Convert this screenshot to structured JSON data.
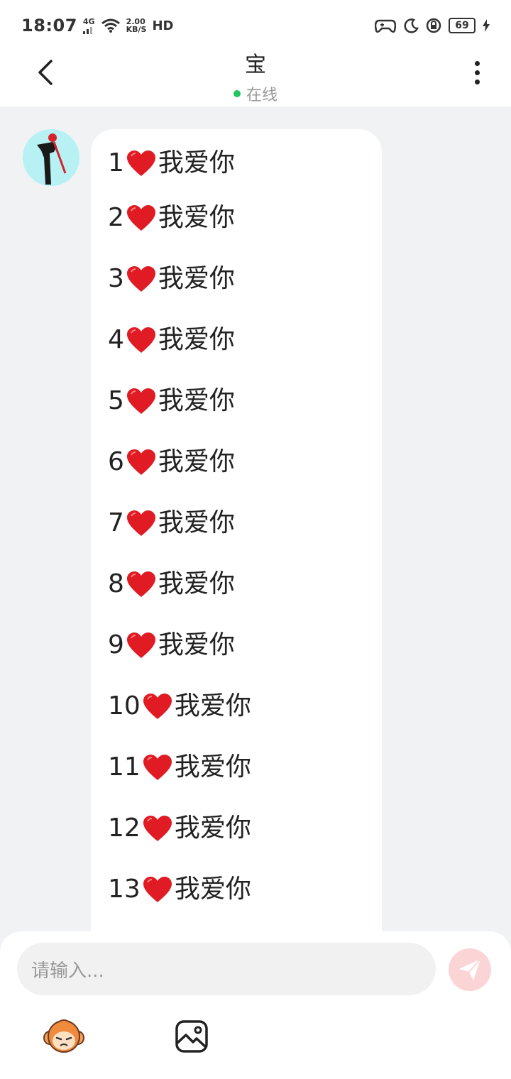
{
  "status_bar": {
    "time": "18:07",
    "network": "4G",
    "speed_value": "2.00",
    "speed_unit": "KB/S",
    "hd": "HD",
    "battery": "69"
  },
  "header": {
    "title": "宝",
    "status": "在线"
  },
  "messages": [
    {
      "num": "1",
      "text": "我爱你"
    },
    {
      "num": "2",
      "text": "我爱你"
    },
    {
      "num": "3",
      "text": "我爱你"
    },
    {
      "num": "4",
      "text": "我爱你"
    },
    {
      "num": "5",
      "text": "我爱你"
    },
    {
      "num": "6",
      "text": "我爱你"
    },
    {
      "num": "7",
      "text": "我爱你"
    },
    {
      "num": "8",
      "text": "我爱你"
    },
    {
      "num": "9",
      "text": "我爱你"
    },
    {
      "num": "10",
      "text": "我爱你"
    },
    {
      "num": "11",
      "text": "我爱你"
    },
    {
      "num": "12",
      "text": "我爱你"
    },
    {
      "num": "13",
      "text": "我爱你"
    }
  ],
  "composer": {
    "placeholder": "请输入..."
  },
  "icons": {
    "back": "chevron-left-icon",
    "more": "more-vertical-icon",
    "send": "paper-plane-icon",
    "emoji": "monkey-emoji-icon",
    "image": "image-icon"
  },
  "colors": {
    "online": "#22c55e",
    "heart": "#e01b24",
    "send_bg": "#fbd5d5"
  }
}
